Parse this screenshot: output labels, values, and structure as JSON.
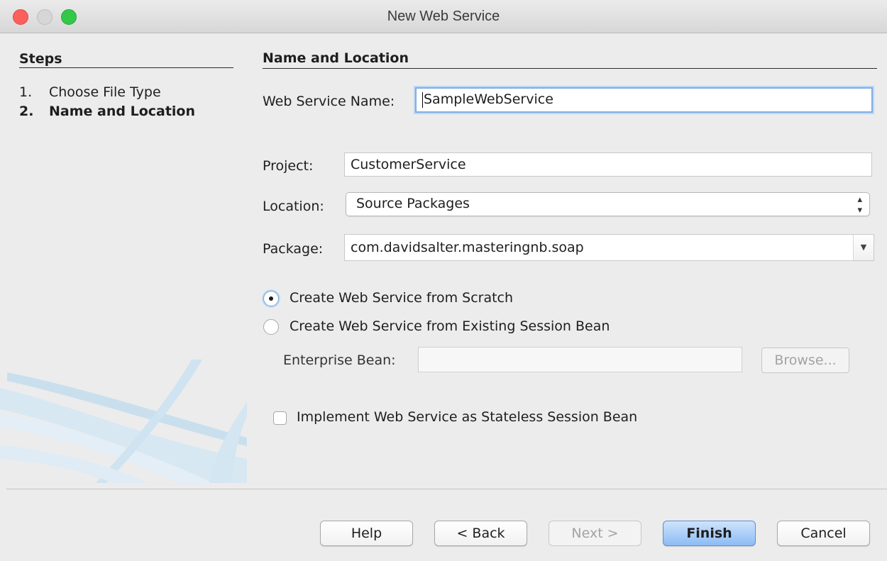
{
  "window": {
    "title": "New Web Service"
  },
  "steps": {
    "title": "Steps",
    "items": [
      {
        "num": "1.",
        "label": "Choose File Type"
      },
      {
        "num": "2.",
        "label": "Name and Location"
      }
    ]
  },
  "section": {
    "title": "Name and Location"
  },
  "form": {
    "name_label": "Web Service Name:",
    "name_value": "SampleWebService",
    "project_label": "Project:",
    "project_value": "CustomerService",
    "location_label": "Location:",
    "location_value": "Source Packages",
    "package_label": "Package:",
    "package_value": "com.davidsalter.masteringnb.soap",
    "radio_scratch": "Create Web Service from Scratch",
    "radio_session": "Create Web Service from Existing Session Bean",
    "bean_label": "Enterprise Bean:",
    "bean_value": "",
    "browse_label": "Browse...",
    "stateless_label": "Implement Web Service as Stateless Session Bean"
  },
  "buttons": {
    "help": "Help",
    "back": "< Back",
    "next": "Next >",
    "finish": "Finish",
    "cancel": "Cancel"
  },
  "colors": {
    "accent": "#7eaee6",
    "default_button": "#8bbcf5",
    "background": "#ececec"
  }
}
